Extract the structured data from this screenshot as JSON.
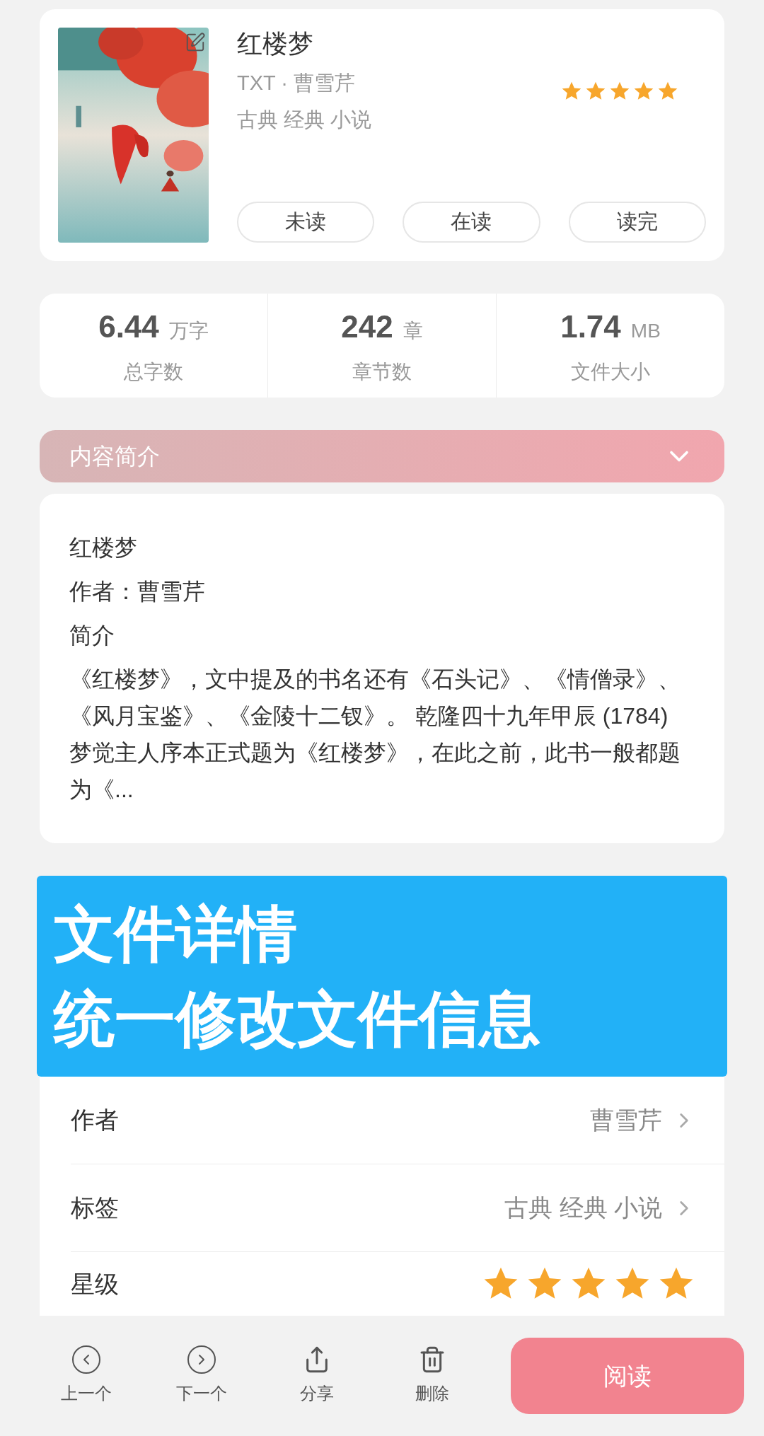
{
  "book": {
    "title": "红楼梦",
    "meta": "TXT · 曹雪芹",
    "tags": "古典 经典 小说",
    "stars": 5,
    "status_buttons": [
      {
        "label": "未读",
        "selected": false
      },
      {
        "label": "在读",
        "selected": false
      },
      {
        "label": "读完",
        "selected": false
      }
    ]
  },
  "stats": [
    {
      "value": "6.44",
      "unit": "万字",
      "label": "总字数"
    },
    {
      "value": "242",
      "unit": "章",
      "label": "章节数"
    },
    {
      "value": "1.74",
      "unit": "MB",
      "label": "文件大小"
    }
  ],
  "summary": {
    "header": "内容简介",
    "expanded": true,
    "lines": [
      "红楼梦",
      "作者：曹雪芹",
      "简介"
    ],
    "text": "《红楼梦》，文中提及的书名还有《石头记》、《情僧录》、《风月宝鉴》、《金陵十二钗》。 乾隆四十九年甲辰 (1784) 梦觉主人序本正式题为《红楼梦》，在此之前，此书一般都题为《..."
  },
  "banner": [
    "文件详情",
    "统一修改文件信息"
  ],
  "details": [
    {
      "kind": "text",
      "label": "作者",
      "value": "曹雪芹"
    },
    {
      "kind": "text",
      "label": "标签",
      "value": "古典 经典 小说"
    },
    {
      "kind": "stars",
      "label": "星级",
      "stars": 5
    }
  ],
  "bottom_bar": {
    "actions": [
      {
        "kind": "prev",
        "label": "上一个"
      },
      {
        "kind": "next",
        "label": "下一个"
      },
      {
        "kind": "share",
        "label": "分享"
      },
      {
        "kind": "delete",
        "label": "删除"
      }
    ],
    "read_button": "阅读"
  }
}
